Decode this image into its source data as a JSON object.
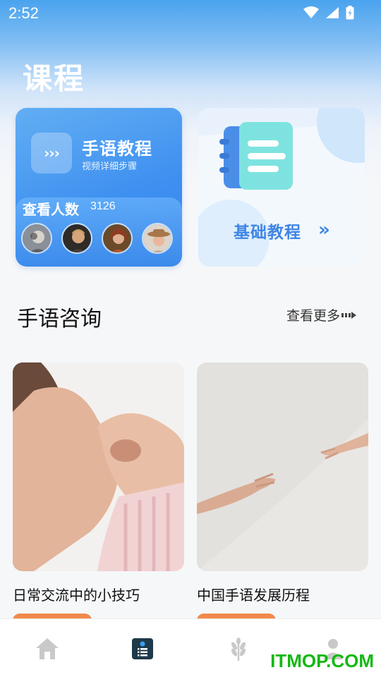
{
  "status_bar": {
    "time": "2:52"
  },
  "page": {
    "title": "课程"
  },
  "tutorial_card": {
    "icon_glyph": "›››",
    "title": "手语教程",
    "subtitle": "视频详细步骤",
    "viewers_label": "查看人数",
    "viewers_count": "3126"
  },
  "basic_card": {
    "label": "基础教程",
    "arrow": "»"
  },
  "consult_section": {
    "title": "手语咨询",
    "more_label": "查看更多"
  },
  "articles": [
    {
      "title": "日常交流中的小技巧"
    },
    {
      "title": "中国手语发展历程"
    }
  ],
  "bottom_nav": [
    {
      "icon": "home-icon",
      "active": false
    },
    {
      "icon": "course-list-icon",
      "active": true
    },
    {
      "icon": "wheat-icon",
      "active": false
    },
    {
      "icon": "profile-icon",
      "active": false
    }
  ],
  "watermark": "ITMOP.COM",
  "colors": {
    "primary": "#3f86e4",
    "accent_orange": "#f0894b",
    "nav_active": "#1e3a4a",
    "nav_inactive": "#c9c9c9"
  }
}
